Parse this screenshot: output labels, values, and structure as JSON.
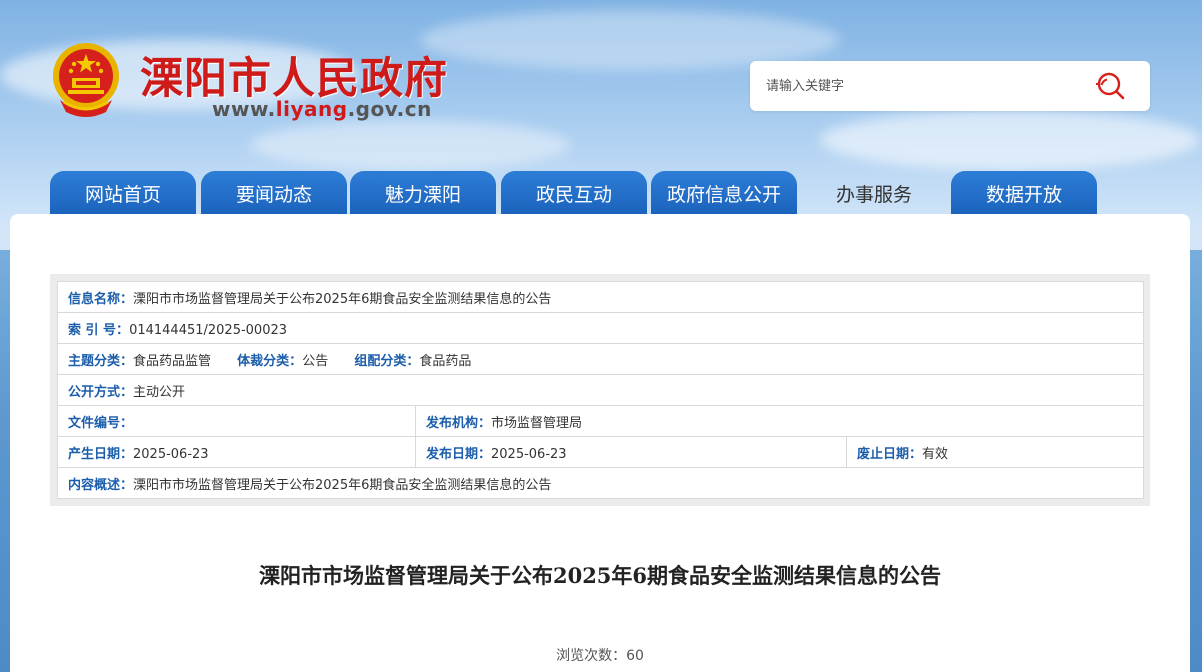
{
  "header": {
    "site_title": "溧阳市人民政府",
    "url_prefix": "www.",
    "url_highlight": "liyang",
    "url_suffix": ".gov.cn",
    "emblem_icon": "national-emblem-icon"
  },
  "search": {
    "placeholder": "请输入关键字",
    "value": "",
    "button_icon": "search-icon"
  },
  "nav": {
    "tabs": [
      {
        "label": "网站首页",
        "active": false
      },
      {
        "label": "要闻动态",
        "active": false
      },
      {
        "label": "魅力溧阳",
        "active": false
      },
      {
        "label": "政民互动",
        "active": false
      },
      {
        "label": "政府信息公开",
        "active": false
      },
      {
        "label": "办事服务",
        "active": true
      },
      {
        "label": "数据开放",
        "active": false
      }
    ]
  },
  "meta": {
    "info_name_label": "信息名称：",
    "info_name_value": "溧阳市市场监督管理局关于公布2025年6期食品安全监测结果信息的公告",
    "index_label": "索 引 号：",
    "index_value": "014144451/2025-00023",
    "topic_label": "主题分类：",
    "topic_value": "食品药品监管",
    "genre_label": "体裁分类：",
    "genre_value": "公告",
    "group_label": "组配分类：",
    "group_value": "食品药品",
    "open_label": "公开方式：",
    "open_value": "主动公开",
    "file_no_label": "文件编号：",
    "file_no_value": "",
    "publisher_label": "发布机构：",
    "publisher_value": "市场监督管理局",
    "created_label": "产生日期：",
    "created_value": "2025-06-23",
    "published_label": "发布日期：",
    "published_value": "2025-06-23",
    "expiry_label": "废止日期：",
    "expiry_value": "有效",
    "summary_label": "内容概述：",
    "summary_value": "溧阳市市场监督管理局关于公布2025年6期食品安全监测结果信息的公告"
  },
  "article": {
    "title": "溧阳市市场监督管理局关于公布2025年6期食品安全监测结果信息的公告",
    "views_label": "浏览次数：",
    "views_count": "60"
  },
  "colors": {
    "brand_red": "#cf1a1a",
    "nav_blue": "#1b63bd",
    "label_blue": "#1c5eab"
  }
}
